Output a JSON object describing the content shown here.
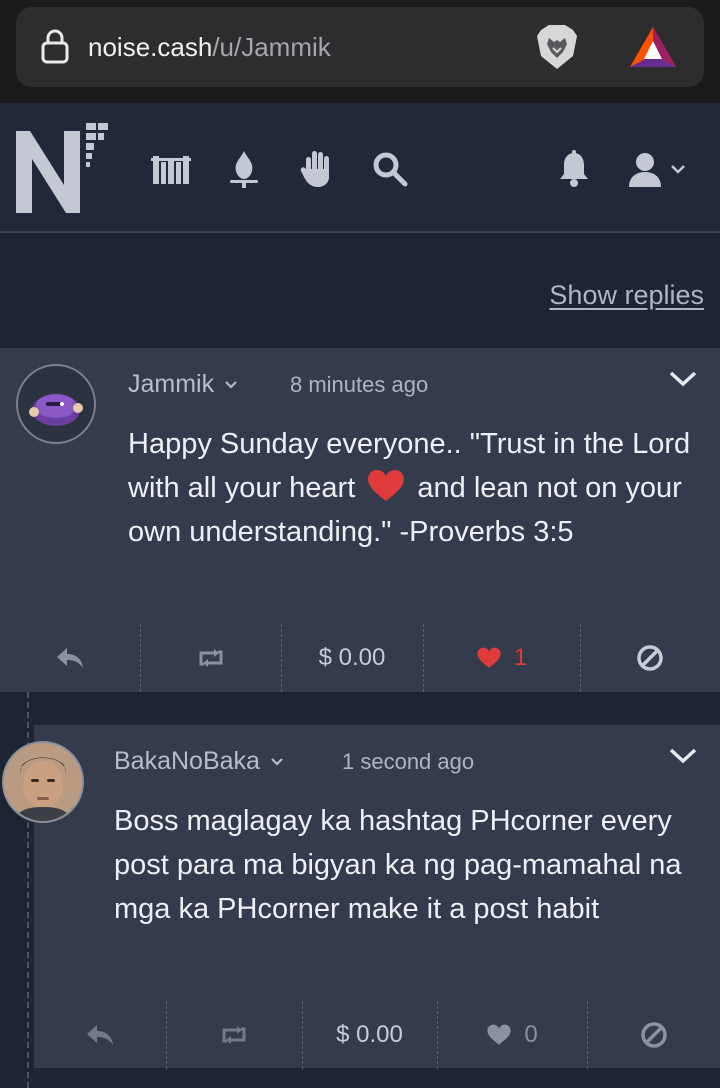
{
  "browser": {
    "url_domain": "noise.cash",
    "url_path": "/u/Jammik"
  },
  "nav": {
    "icons": [
      "library-icon",
      "fire-icon",
      "hand-icon",
      "search-icon",
      "bell-icon",
      "user-icon"
    ]
  },
  "show_replies_label": "Show replies",
  "posts": [
    {
      "author": "Jammik",
      "timestamp": "8 minutes ago",
      "text_before": "Happy Sunday everyone.. \"Trust in the Lord with all your heart ",
      "text_after": " and lean not on your own understanding.\" -Proverbs 3:5",
      "tip": "$ 0.00",
      "likes": "1",
      "liked": true
    },
    {
      "author": "BakaNoBaka",
      "timestamp": "1 second ago",
      "text": "Boss maglagay ka hashtag PHcorner every post para ma bigyan ka ng pag-mamahal na mga ka PHcorner make it a post habit",
      "tip": "$ 0.00",
      "likes": "0",
      "liked": false
    }
  ],
  "colors": {
    "liked": "#e03b3b",
    "muted_icon": "#8a91a0",
    "post_bg": "#343b4c",
    "page_bg": "#1e2432"
  }
}
